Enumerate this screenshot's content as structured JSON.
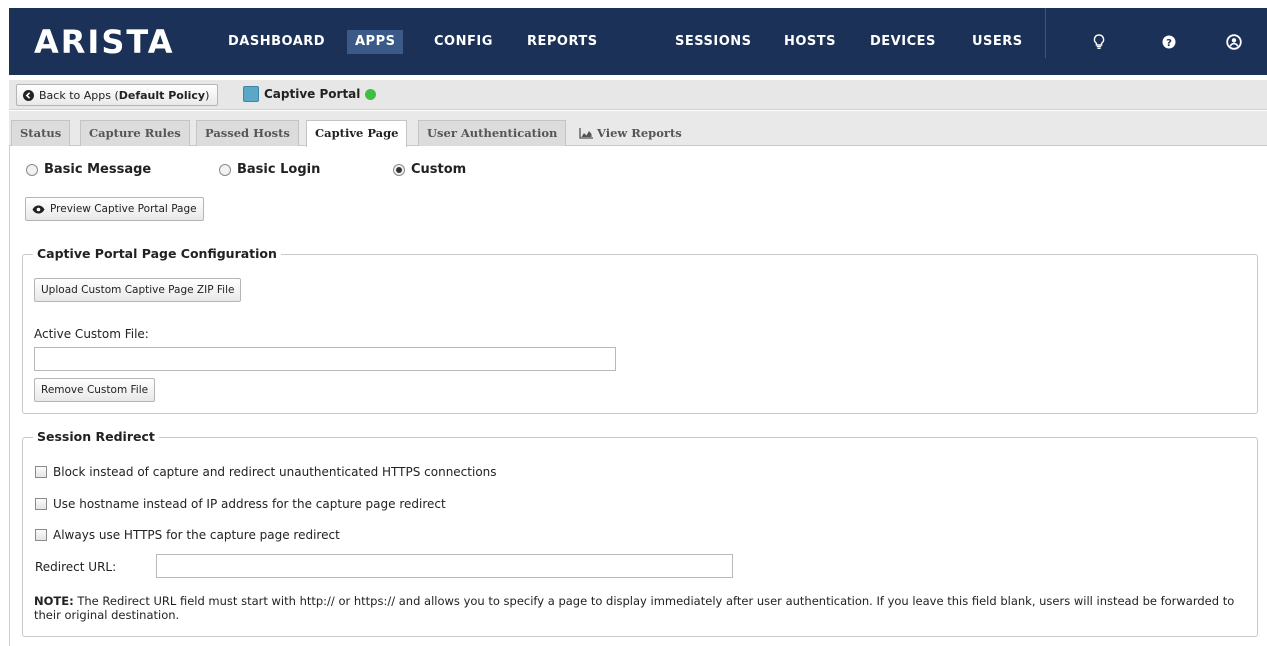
{
  "nav": {
    "logo": "ARISTA",
    "items": [
      "DASHBOARD",
      "APPS",
      "CONFIG",
      "REPORTS",
      "SESSIONS",
      "HOSTS",
      "DEVICES",
      "USERS"
    ],
    "active": "APPS",
    "icons": [
      "lightbulb-icon",
      "help-icon",
      "user-icon"
    ]
  },
  "breadcrumb": {
    "back_prefix": "Back to Apps (",
    "policy": "Default Policy",
    "back_suffix": ")",
    "app_name": "Captive Portal",
    "app_status_color": "#3fbf3f"
  },
  "tabs": [
    "Status",
    "Capture Rules",
    "Passed Hosts",
    "Captive Page",
    "User Authentication"
  ],
  "active_tab": "Captive Page",
  "view_reports": "View Reports",
  "page_type": {
    "options": [
      "Basic Message",
      "Basic Login",
      "Custom"
    ],
    "selected": "Custom"
  },
  "preview_button": "Preview Captive Portal Page",
  "config_section": {
    "legend": "Captive Portal Page Configuration",
    "upload_button": "Upload Custom Captive Page ZIP File",
    "active_file_label": "Active Custom File:",
    "active_file_value": "",
    "remove_button": "Remove Custom File"
  },
  "redirect_section": {
    "legend": "Session Redirect",
    "checkboxes": [
      {
        "label": "Block instead of capture and redirect unauthenticated HTTPS connections",
        "checked": false
      },
      {
        "label": "Use hostname instead of IP address for the capture page redirect",
        "checked": false
      },
      {
        "label": "Always use HTTPS for the capture page redirect",
        "checked": false
      }
    ],
    "redirect_label": "Redirect URL:",
    "redirect_value": "",
    "note_label": "NOTE:",
    "note_text": "The Redirect URL field must start with http:// or https:// and allows you to specify a page to display immediately after user authentication. If you leave this field blank, users will instead be forwarded to their original destination."
  },
  "colors": {
    "nav_bg": "#1b3157",
    "nav_active": "#3b5a87"
  }
}
